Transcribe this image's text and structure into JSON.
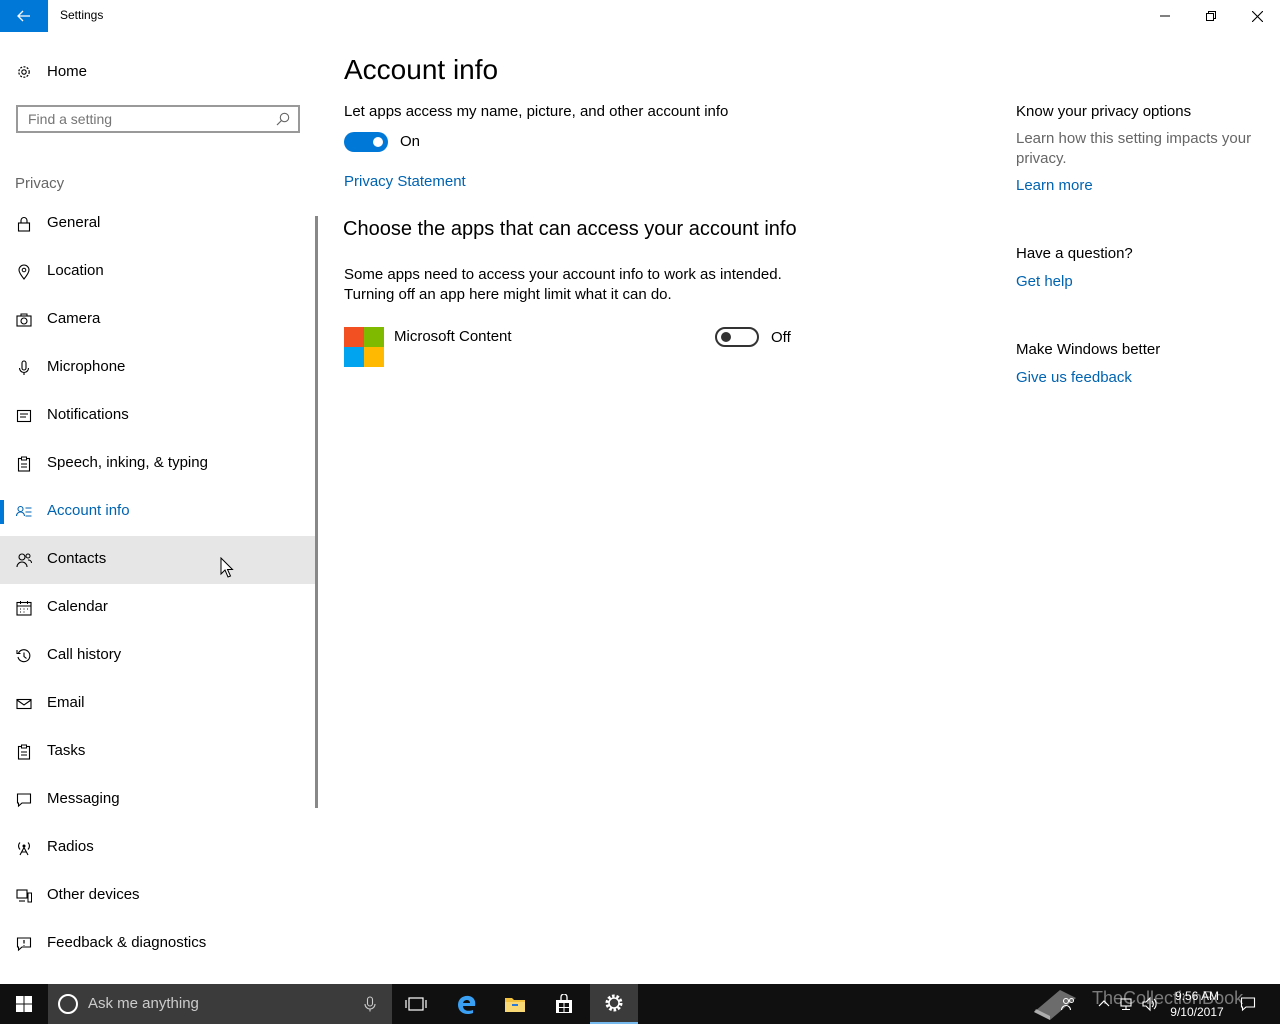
{
  "window": {
    "title": "Settings"
  },
  "sidebar": {
    "home_label": "Home",
    "search_placeholder": "Find a setting",
    "section_label": "Privacy",
    "items": [
      {
        "label": "General",
        "icon": "lock-icon"
      },
      {
        "label": "Location",
        "icon": "location-icon"
      },
      {
        "label": "Camera",
        "icon": "camera-icon"
      },
      {
        "label": "Microphone",
        "icon": "microphone-icon"
      },
      {
        "label": "Notifications",
        "icon": "notifications-icon"
      },
      {
        "label": "Speech, inking, & typing",
        "icon": "clipboard-icon"
      },
      {
        "label": "Account info",
        "icon": "account-info-icon",
        "active": true
      },
      {
        "label": "Contacts",
        "icon": "contacts-icon",
        "hover": true
      },
      {
        "label": "Calendar",
        "icon": "calendar-icon"
      },
      {
        "label": "Call history",
        "icon": "history-icon"
      },
      {
        "label": "Email",
        "icon": "mail-icon"
      },
      {
        "label": "Tasks",
        "icon": "tasks-icon"
      },
      {
        "label": "Messaging",
        "icon": "messaging-icon"
      },
      {
        "label": "Radios",
        "icon": "radios-icon"
      },
      {
        "label": "Other devices",
        "icon": "devices-icon"
      },
      {
        "label": "Feedback & diagnostics",
        "icon": "feedback-icon"
      }
    ]
  },
  "main": {
    "title": "Account info",
    "access_description": "Let apps access my name, picture, and other account info",
    "access_toggle": {
      "state": "on",
      "label": "On"
    },
    "privacy_link": "Privacy Statement",
    "apps_heading": "Choose the apps that can access your account info",
    "apps_desc_line1": "Some apps need to access your account info to work as intended.",
    "apps_desc_line2": "Turning off an app here might limit what it can do.",
    "apps": [
      {
        "name": "Microsoft Content",
        "toggle_state": "off",
        "toggle_label": "Off"
      }
    ]
  },
  "right_panel": {
    "privacy_heading": "Know your privacy options",
    "privacy_text": "Learn how this setting impacts your privacy.",
    "learn_more": "Learn more",
    "question_heading": "Have a question?",
    "get_help": "Get help",
    "better_heading": "Make Windows better",
    "feedback_link": "Give us feedback"
  },
  "taskbar": {
    "search_placeholder": "Ask me anything",
    "time": "9:56 AM",
    "date": "9/10/2017",
    "watermark": "TheCollectionBook"
  },
  "colors": {
    "accent": "#0078d7",
    "link": "#0063b1",
    "taskbar": "#101010"
  }
}
